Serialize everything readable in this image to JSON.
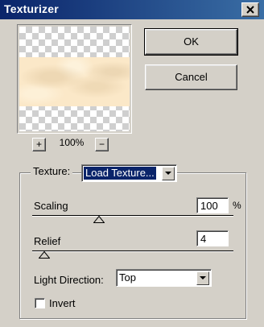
{
  "window": {
    "title": "Texturizer"
  },
  "preview": {
    "zoom": "100%",
    "zoom_in_label": "+",
    "zoom_out_label": "−"
  },
  "buttons": {
    "ok": "OK",
    "cancel": "Cancel"
  },
  "texture": {
    "label": "Texture:",
    "selected": "Load Texture..."
  },
  "scaling": {
    "label": "Scaling",
    "value": "100",
    "unit": "%",
    "slider_fraction": 0.33
  },
  "relief": {
    "label": "Relief",
    "value": "4",
    "slider_fraction": 0.06
  },
  "light_direction": {
    "label": "Light Direction:",
    "selected": "Top"
  },
  "invert": {
    "label": "Invert",
    "checked": false
  },
  "colors": {
    "titlebar_start": "#0a246a",
    "titlebar_end": "#3a6ea5",
    "dialog_bg": "#d4d0c8",
    "texture_fill": "#fbe8c8"
  }
}
